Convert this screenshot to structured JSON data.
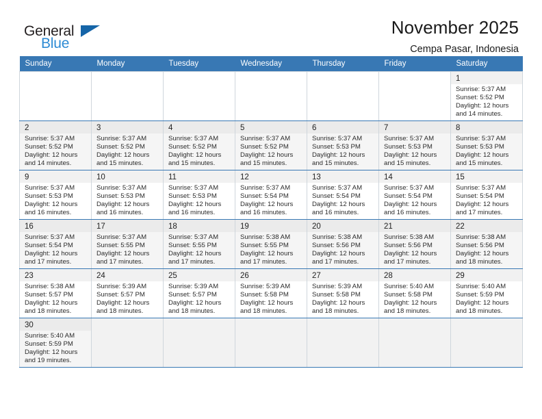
{
  "logo": {
    "word_one": "General",
    "word_two": "Blue",
    "triangle_color": "#1565a8",
    "blue_color": "#2e8bd4"
  },
  "header": {
    "title": "November 2025",
    "subtitle": "Cempa Pasar, Indonesia"
  },
  "theme": {
    "header_bg": "#3878b4",
    "header_text": "#ffffff",
    "grid_line": "#cfd6dc",
    "row_divider": "#3878b4",
    "alt_row_bg": "#f5f5f5",
    "empty_cell_bg": "#f2f2f2"
  },
  "weekday_headers": [
    "Sunday",
    "Monday",
    "Tuesday",
    "Wednesday",
    "Thursday",
    "Friday",
    "Saturday"
  ],
  "weeks": [
    {
      "days": [
        {
          "num": "",
          "info": "",
          "empty": true
        },
        {
          "num": "",
          "info": "",
          "empty": true
        },
        {
          "num": "",
          "info": "",
          "empty": true
        },
        {
          "num": "",
          "info": "",
          "empty": true
        },
        {
          "num": "",
          "info": "",
          "empty": true
        },
        {
          "num": "",
          "info": "",
          "empty": true
        },
        {
          "num": "1",
          "info": "Sunrise: 5:37 AM\nSunset: 5:52 PM\nDaylight: 12 hours\nand 14 minutes.",
          "empty": false
        }
      ]
    },
    {
      "days": [
        {
          "num": "2",
          "info": "Sunrise: 5:37 AM\nSunset: 5:52 PM\nDaylight: 12 hours\nand 14 minutes.",
          "empty": false
        },
        {
          "num": "3",
          "info": "Sunrise: 5:37 AM\nSunset: 5:52 PM\nDaylight: 12 hours\nand 15 minutes.",
          "empty": false
        },
        {
          "num": "4",
          "info": "Sunrise: 5:37 AM\nSunset: 5:52 PM\nDaylight: 12 hours\nand 15 minutes.",
          "empty": false
        },
        {
          "num": "5",
          "info": "Sunrise: 5:37 AM\nSunset: 5:52 PM\nDaylight: 12 hours\nand 15 minutes.",
          "empty": false
        },
        {
          "num": "6",
          "info": "Sunrise: 5:37 AM\nSunset: 5:53 PM\nDaylight: 12 hours\nand 15 minutes.",
          "empty": false
        },
        {
          "num": "7",
          "info": "Sunrise: 5:37 AM\nSunset: 5:53 PM\nDaylight: 12 hours\nand 15 minutes.",
          "empty": false
        },
        {
          "num": "8",
          "info": "Sunrise: 5:37 AM\nSunset: 5:53 PM\nDaylight: 12 hours\nand 15 minutes.",
          "empty": false
        }
      ]
    },
    {
      "days": [
        {
          "num": "9",
          "info": "Sunrise: 5:37 AM\nSunset: 5:53 PM\nDaylight: 12 hours\nand 16 minutes.",
          "empty": false
        },
        {
          "num": "10",
          "info": "Sunrise: 5:37 AM\nSunset: 5:53 PM\nDaylight: 12 hours\nand 16 minutes.",
          "empty": false
        },
        {
          "num": "11",
          "info": "Sunrise: 5:37 AM\nSunset: 5:53 PM\nDaylight: 12 hours\nand 16 minutes.",
          "empty": false
        },
        {
          "num": "12",
          "info": "Sunrise: 5:37 AM\nSunset: 5:54 PM\nDaylight: 12 hours\nand 16 minutes.",
          "empty": false
        },
        {
          "num": "13",
          "info": "Sunrise: 5:37 AM\nSunset: 5:54 PM\nDaylight: 12 hours\nand 16 minutes.",
          "empty": false
        },
        {
          "num": "14",
          "info": "Sunrise: 5:37 AM\nSunset: 5:54 PM\nDaylight: 12 hours\nand 16 minutes.",
          "empty": false
        },
        {
          "num": "15",
          "info": "Sunrise: 5:37 AM\nSunset: 5:54 PM\nDaylight: 12 hours\nand 17 minutes.",
          "empty": false
        }
      ]
    },
    {
      "days": [
        {
          "num": "16",
          "info": "Sunrise: 5:37 AM\nSunset: 5:54 PM\nDaylight: 12 hours\nand 17 minutes.",
          "empty": false
        },
        {
          "num": "17",
          "info": "Sunrise: 5:37 AM\nSunset: 5:55 PM\nDaylight: 12 hours\nand 17 minutes.",
          "empty": false
        },
        {
          "num": "18",
          "info": "Sunrise: 5:37 AM\nSunset: 5:55 PM\nDaylight: 12 hours\nand 17 minutes.",
          "empty": false
        },
        {
          "num": "19",
          "info": "Sunrise: 5:38 AM\nSunset: 5:55 PM\nDaylight: 12 hours\nand 17 minutes.",
          "empty": false
        },
        {
          "num": "20",
          "info": "Sunrise: 5:38 AM\nSunset: 5:56 PM\nDaylight: 12 hours\nand 17 minutes.",
          "empty": false
        },
        {
          "num": "21",
          "info": "Sunrise: 5:38 AM\nSunset: 5:56 PM\nDaylight: 12 hours\nand 17 minutes.",
          "empty": false
        },
        {
          "num": "22",
          "info": "Sunrise: 5:38 AM\nSunset: 5:56 PM\nDaylight: 12 hours\nand 18 minutes.",
          "empty": false
        }
      ]
    },
    {
      "days": [
        {
          "num": "23",
          "info": "Sunrise: 5:38 AM\nSunset: 5:57 PM\nDaylight: 12 hours\nand 18 minutes.",
          "empty": false
        },
        {
          "num": "24",
          "info": "Sunrise: 5:39 AM\nSunset: 5:57 PM\nDaylight: 12 hours\nand 18 minutes.",
          "empty": false
        },
        {
          "num": "25",
          "info": "Sunrise: 5:39 AM\nSunset: 5:57 PM\nDaylight: 12 hours\nand 18 minutes.",
          "empty": false
        },
        {
          "num": "26",
          "info": "Sunrise: 5:39 AM\nSunset: 5:58 PM\nDaylight: 12 hours\nand 18 minutes.",
          "empty": false
        },
        {
          "num": "27",
          "info": "Sunrise: 5:39 AM\nSunset: 5:58 PM\nDaylight: 12 hours\nand 18 minutes.",
          "empty": false
        },
        {
          "num": "28",
          "info": "Sunrise: 5:40 AM\nSunset: 5:58 PM\nDaylight: 12 hours\nand 18 minutes.",
          "empty": false
        },
        {
          "num": "29",
          "info": "Sunrise: 5:40 AM\nSunset: 5:59 PM\nDaylight: 12 hours\nand 18 minutes.",
          "empty": false
        }
      ]
    },
    {
      "days": [
        {
          "num": "30",
          "info": "Sunrise: 5:40 AM\nSunset: 5:59 PM\nDaylight: 12 hours\nand 19 minutes.",
          "empty": false
        },
        {
          "num": "",
          "info": "",
          "empty": true
        },
        {
          "num": "",
          "info": "",
          "empty": true
        },
        {
          "num": "",
          "info": "",
          "empty": true
        },
        {
          "num": "",
          "info": "",
          "empty": true
        },
        {
          "num": "",
          "info": "",
          "empty": true
        },
        {
          "num": "",
          "info": "",
          "empty": true
        }
      ]
    }
  ]
}
